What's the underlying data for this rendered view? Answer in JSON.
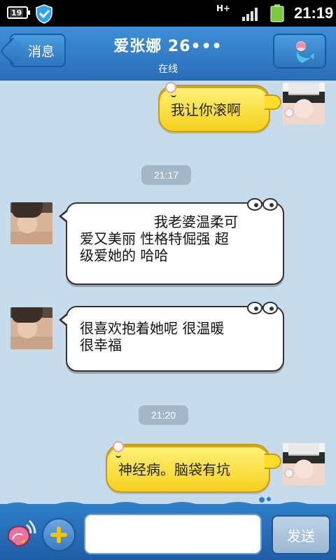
{
  "status_bar": {
    "battery_level": "19",
    "network_type": "H+",
    "time": "21:19"
  },
  "header": {
    "back_label": "消息",
    "title": "爱张娜 26•••",
    "subtitle": "在线"
  },
  "messages": [
    {
      "side": "right",
      "style": "yellow",
      "text": "我让你滚啊"
    },
    {
      "type": "timestamp",
      "text": "21:17"
    },
    {
      "side": "left",
      "style": "white",
      "text": "我老婆温柔可爱又美丽 性格特倔强 超级爱她的 哈哈",
      "lines": [
        "我老婆温柔可",
        "爱又美丽 性格特倔强 超",
        "级爱她的 哈哈"
      ]
    },
    {
      "side": "left",
      "style": "white",
      "text": "很喜欢抱着她呢 很温暖很幸福",
      "lines": [
        "很喜欢抱着她呢 很温暖",
        "很幸福"
      ]
    },
    {
      "type": "timestamp",
      "text": "21:20"
    },
    {
      "side": "right",
      "style": "yellow",
      "text": "神经病。脑袋有坑"
    }
  ],
  "input_bar": {
    "message_value": "",
    "send_label": "发送"
  },
  "colors": {
    "header_blue": "#2f7ec9",
    "chat_background": "#c7dbeb",
    "yellow_bubble": "#f9de2c",
    "timestamp_chip": "#a3b7c8"
  }
}
